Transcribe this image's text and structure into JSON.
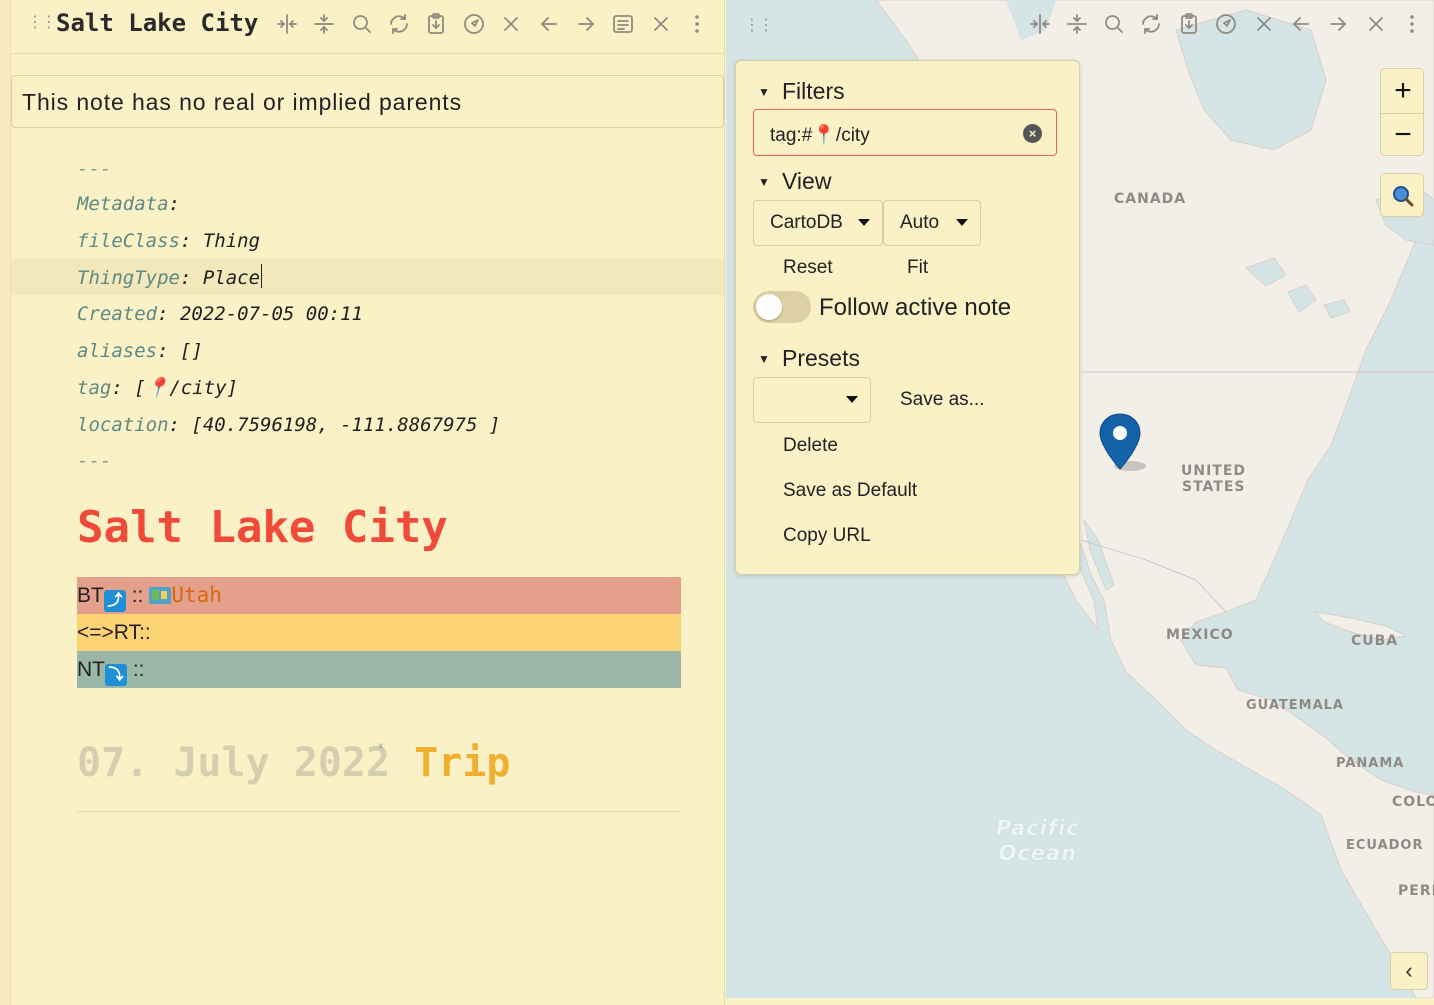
{
  "left": {
    "title": "Salt Lake City",
    "parents_notice": "This note has no real or implied parents",
    "frontmatter": {
      "open_fence": "---",
      "close_fence": "---",
      "lines": [
        {
          "key": "Metadata",
          "sep": ":",
          "value": ""
        },
        {
          "key": "fileClass",
          "sep": ": ",
          "value": "Thing"
        },
        {
          "key": "ThingType",
          "sep": ": ",
          "value": "Place"
        },
        {
          "key": "Created",
          "sep": ": ",
          "value": "2022-07-05 00:11"
        },
        {
          "key": "aliases",
          "sep": ": ",
          "value": "[]"
        },
        {
          "key": "tag",
          "sep": ": ",
          "value": "[📍/city]"
        },
        {
          "key": "location",
          "sep": ": ",
          "value": "[40.7596198, -111.8867975 ]"
        }
      ]
    },
    "heading": "Salt Lake City",
    "breadcrumbs": {
      "bt_label": "BT",
      "bt_arrow": "⤴",
      "bt_sep": "::",
      "bt_link": "Utah",
      "rt_label": "<=>RT::",
      "nt_label": "NT",
      "nt_arrow": "⤵",
      "nt_sep": "::",
      "colors": {
        "bt": "#e5a08c",
        "rt": "#fbd374",
        "nt": "#9bb7a7"
      }
    },
    "subheading": {
      "date": "07. July 2022",
      "x_mark": "ˣ",
      "link": "Trip"
    }
  },
  "map": {
    "labels": {
      "canada": "CANADA",
      "us_line1": "UNITED",
      "us_line2": "STATES",
      "mexico": "MEXICO",
      "cuba": "CUBA",
      "guatemala": "GUATEMALA",
      "panama": "PANAMA",
      "colombia": "COLO",
      "ecuador": "ECUADOR",
      "peru": "PERI",
      "pacific_line1": "Pacific",
      "pacific_line2": "Ocean"
    },
    "zoom_in": "+",
    "zoom_out": "−",
    "collapse": "‹",
    "marker_color": "#1662a8",
    "colors": {
      "water": "#d5e5e6",
      "land": "#f2efe9"
    }
  },
  "panel": {
    "filters_title": "Filters",
    "filter_value": "tag:#📍/city",
    "filter_clear": "×",
    "view_title": "View",
    "tile_provider": "CartoDB",
    "zoom_mode": "Auto",
    "reset_label": "Reset",
    "fit_label": "Fit",
    "follow_label": "Follow active note",
    "follow_on": false,
    "presets_title": "Presets",
    "preset_selected": "",
    "save_as_label": "Save as...",
    "delete_label": "Delete",
    "save_default_label": "Save as Default",
    "copy_url_label": "Copy URL",
    "triangle": "▼"
  }
}
